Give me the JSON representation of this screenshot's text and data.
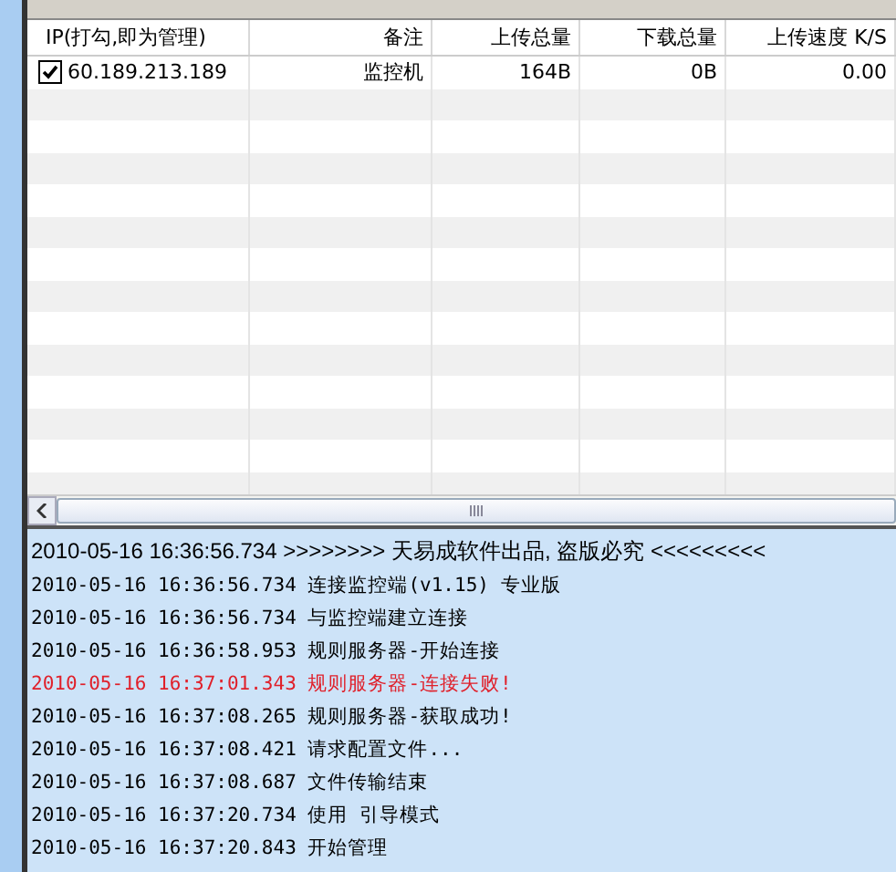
{
  "table": {
    "columns": [
      "IP(打勾,即为管理)",
      "备注",
      "上传总量",
      "下载总量",
      "上传速度 K/S"
    ],
    "rows": [
      {
        "checked": true,
        "cells": [
          "60.189.213.189",
          "监控机",
          "164B",
          "0B",
          "0.00"
        ]
      }
    ]
  },
  "log": [
    {
      "kind": "banner",
      "text": "2010-05-16 16:36:56.734 >>>>>>>>  天易成软件出品, 盗版必究   <<<<<<<<<"
    },
    {
      "kind": "normal",
      "text": "2010-05-16 16:36:56.734 连接监控端(v1.15) 专业版"
    },
    {
      "kind": "normal",
      "text": "2010-05-16 16:36:56.734 与监控端建立连接"
    },
    {
      "kind": "normal",
      "text": "2010-05-16 16:36:58.953 规则服务器-开始连接"
    },
    {
      "kind": "error",
      "text": "2010-05-16 16:37:01.343 规则服务器-连接失败!"
    },
    {
      "kind": "normal",
      "text": "2010-05-16 16:37:08.265 规则服务器-获取成功!"
    },
    {
      "kind": "normal",
      "text": "2010-05-16 16:37:08.421 请求配置文件..."
    },
    {
      "kind": "normal",
      "text": "2010-05-16 16:37:08.687 文件传输结束"
    },
    {
      "kind": "normal",
      "text": "2010-05-16 16:37:20.734 使用 引导模式"
    },
    {
      "kind": "normal",
      "text": "2010-05-16 16:37:20.843 开始管理"
    }
  ]
}
